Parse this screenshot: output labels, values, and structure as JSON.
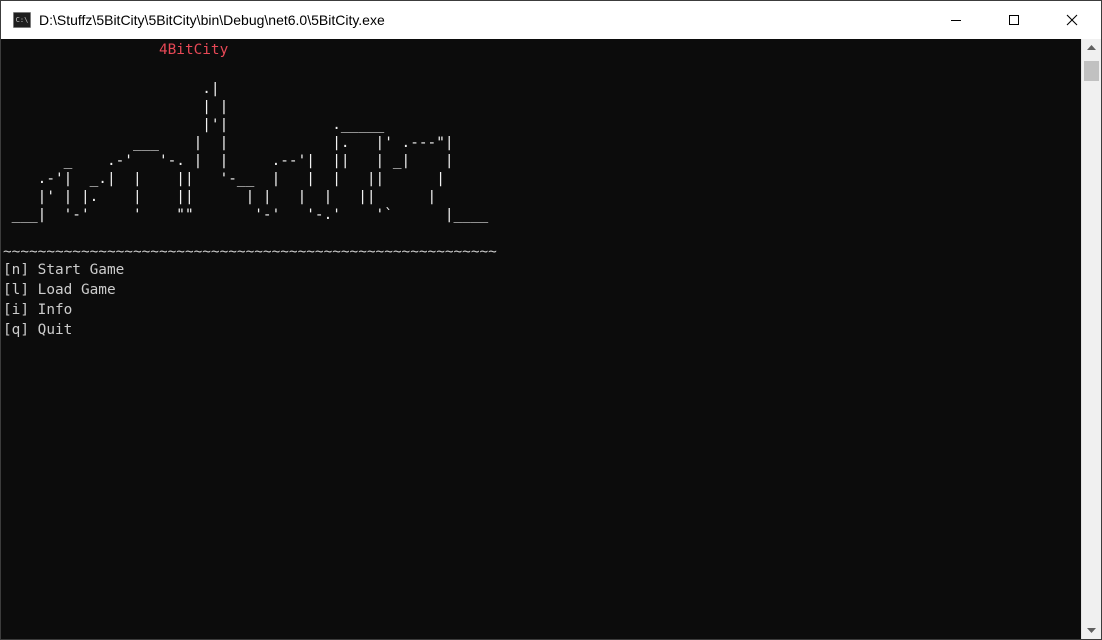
{
  "window": {
    "title": "D:\\Stuffz\\5BitCity\\5BitCity\\bin\\Debug\\net6.0\\5BitCity.exe",
    "icon": "console-app-icon",
    "icon_text": "C:\\"
  },
  "caption_buttons": {
    "minimize_icon": "minimize-icon",
    "maximize_icon": "maximize-icon",
    "close_icon": "close-icon"
  },
  "console": {
    "title": "4BitCity",
    "title_color": "#e74856",
    "skyline_art": [
      "                       .|",
      "                       | |",
      "                       |'|            ._____",
      "               ___    |  |            |.   |' .---\"|",
      "       _    .-'   '-. |  |     .--'|  ||   | _|    |",
      "    .-'|  _.|  |    ||   '-__  |   |  |   ||      |",
      "    |' | |.    |    ||      | |   |  |   ||      |",
      " ___|  '-'     '    \"\"       '-'   '-.'    '`      |____"
    ],
    "water_line": "~~~~~~~~~~~~~~~~~~~~~~~~~~~~~~~~~~~~~~~~~~~~~~~~~~~~~~~~~",
    "menu": [
      {
        "key": "[n]",
        "label": "Start Game"
      },
      {
        "key": "[l]",
        "label": "Load Game"
      },
      {
        "key": "[i]",
        "label": "Info"
      },
      {
        "key": "[q]",
        "label": "Quit"
      }
    ],
    "menu_text": [
      "[n] Start Game",
      "[l] Load Game",
      "[i] Info",
      "[q] Quit"
    ]
  },
  "colors": {
    "background": "#0c0c0c",
    "foreground": "#cccccc",
    "titlebar": "#ffffff"
  }
}
